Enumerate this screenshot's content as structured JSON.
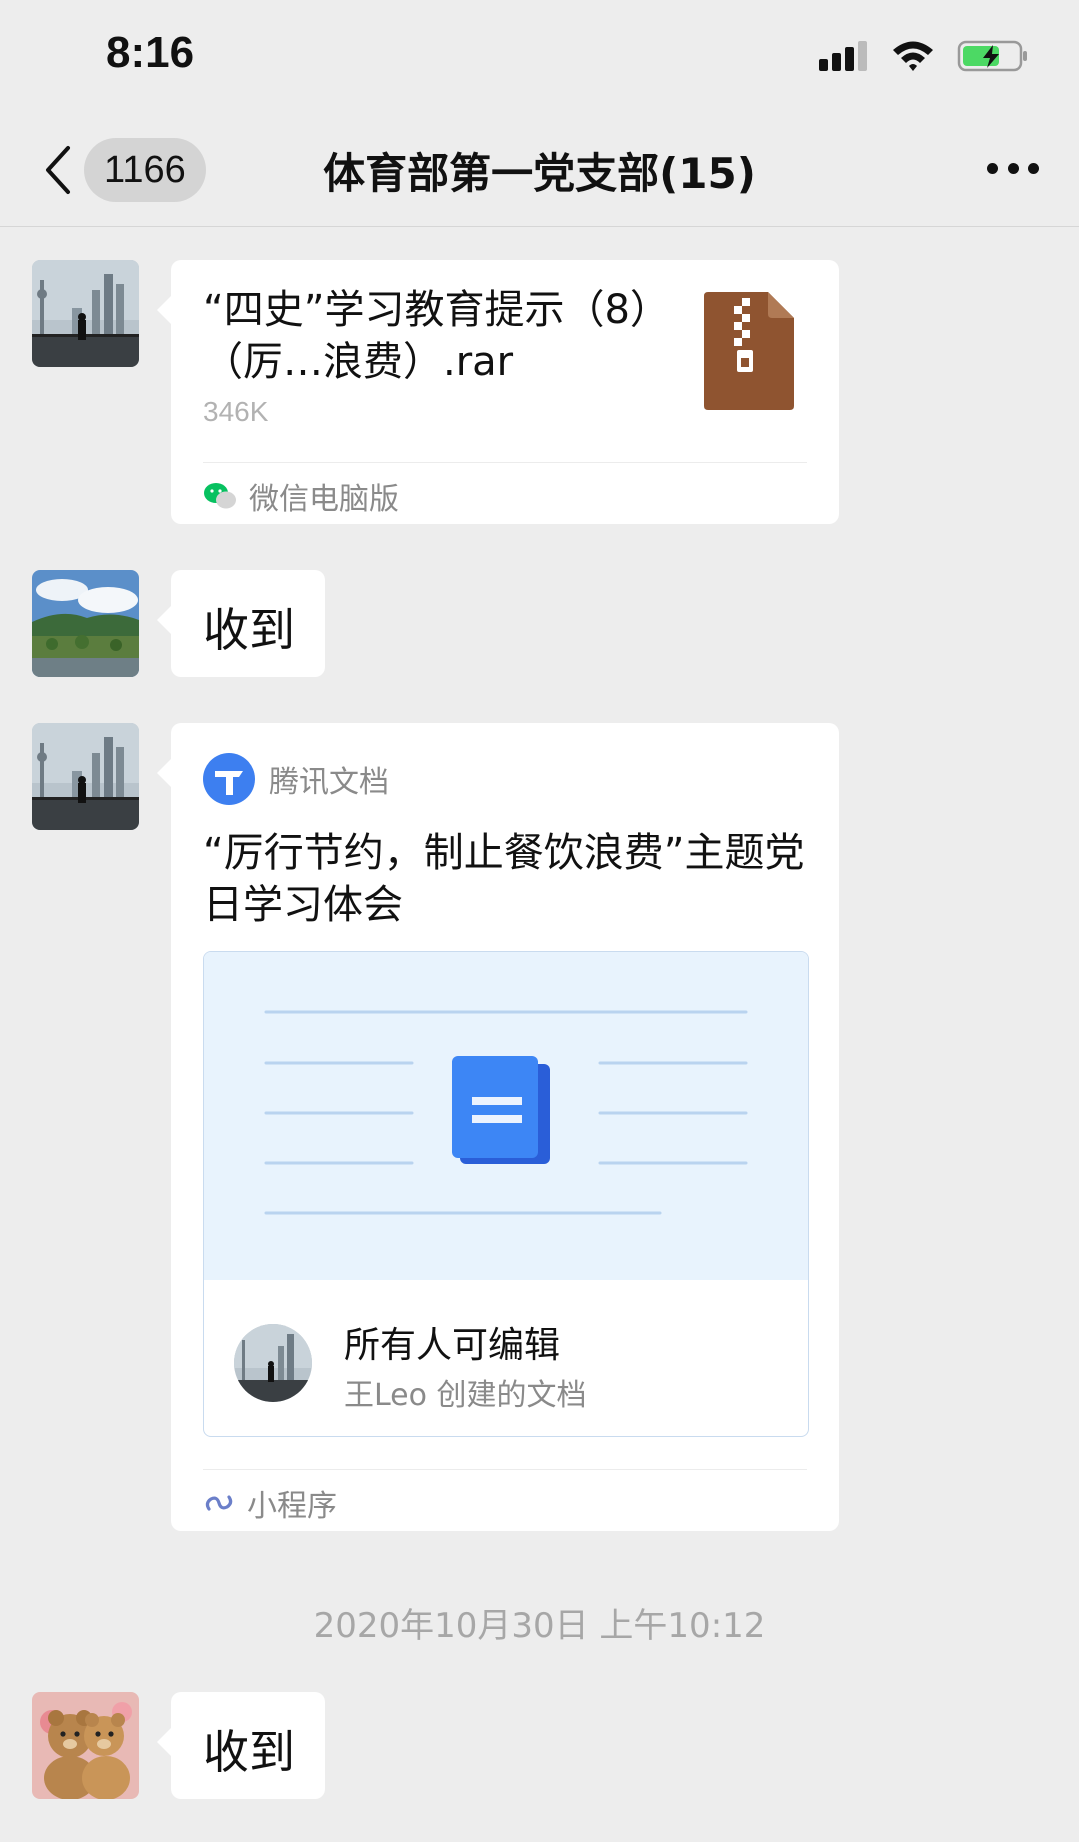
{
  "status_bar": {
    "time": "8:16"
  },
  "nav": {
    "unread_count": "1166",
    "title": "体育部第一党支部(15)"
  },
  "messages": [
    {
      "type": "file",
      "file_name": "“四史”学习教育提示（8）（厉…浪费）.rar",
      "file_size": "346K",
      "source": "微信电脑版",
      "icon": "zip-file-icon"
    },
    {
      "type": "text",
      "text": "收到"
    },
    {
      "type": "doc",
      "app_name": "腾讯文档",
      "title": "“厉行节约，制止餐饮浪费”主题党日学习体会",
      "permission": "所有人可编辑",
      "creator": "王Leo 创建的文档",
      "source": "小程序"
    },
    {
      "type": "text",
      "text": "收到"
    }
  ],
  "timestamp": "2020年10月30日 上午10:12",
  "colors": {
    "background": "#ededed",
    "file_icon": "#8f5430",
    "doc_blue": "#3d7ff0",
    "wechat_green": "#07c160"
  }
}
